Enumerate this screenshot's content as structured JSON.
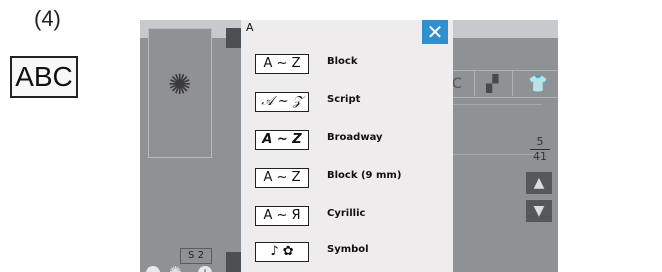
{
  "step": "(4)",
  "abc_button": "ABC",
  "background_screen": {
    "tab_letter": "C",
    "page_current": "5",
    "page_total": "41",
    "size_label": "S 2"
  },
  "dialog": {
    "title": "A",
    "close_glyph": "✕",
    "options": [
      {
        "icon_text": "A ~ Z",
        "label": "Block"
      },
      {
        "icon_text": "𝒜 ~ 𝒵",
        "label": "Script"
      },
      {
        "icon_text": "A ~ Z",
        "label": "Broadway"
      },
      {
        "icon_text": "A ~ Z",
        "label": "Block (9 mm)"
      },
      {
        "icon_text": "A ~ Я",
        "label": "Cyrillic"
      },
      {
        "icon_text": "♪ ✿",
        "label": "Symbol"
      }
    ]
  },
  "colors": {
    "close_button": "#2e8fd1",
    "dimmed_screen": "#8f9294",
    "dialog_bg": "#efeced"
  },
  "icons": [
    "sun-stitch-icon",
    "close-icon",
    "arrow-up-icon",
    "arrow-down-icon",
    "minus-icon",
    "plus-icon",
    "shirt-icon"
  ]
}
